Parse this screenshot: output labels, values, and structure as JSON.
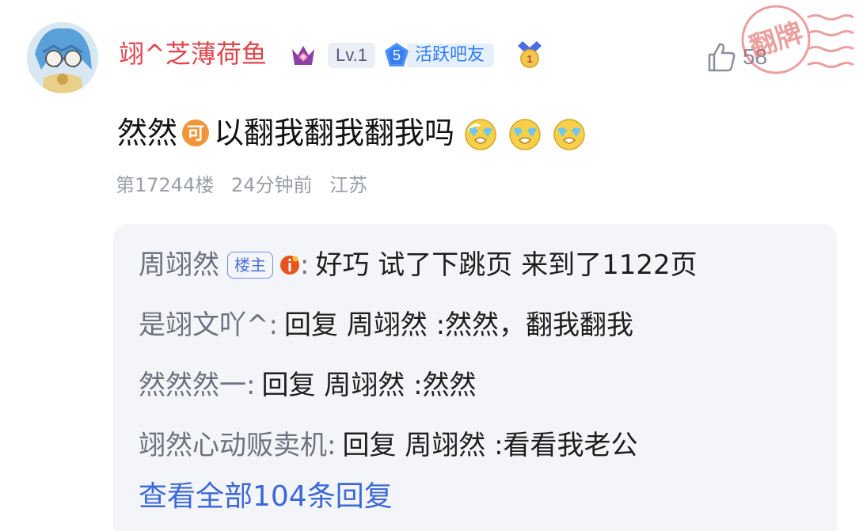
{
  "post": {
    "username": "翊^芝薄荷鱼",
    "level_badge": "Lv.1",
    "active_badge": {
      "number": "5",
      "label": "活跃吧友"
    },
    "like_count": "58",
    "stamp_text": "翻牌",
    "content_before": "然然",
    "content_emoji_ke": "可",
    "content_after": "以翻我翻我翻我吗",
    "meta": {
      "floor": "第17244楼",
      "time": "24分钟前",
      "location": "江苏"
    }
  },
  "replies": [
    {
      "author": "周翊然",
      "badge": "楼主",
      "text": "好巧 试了下跳页 来到了1122页"
    },
    {
      "author": "是翊文吖^",
      "text": "回复 周翊然 :然然，翻我翻我"
    },
    {
      "author": "然然然一",
      "text": "回复 周翊然 :然然"
    },
    {
      "author": "翊然心动贩卖机",
      "text": "回复 周翊然 :看看我老公"
    }
  ],
  "view_all_label": "查看全部104条回复",
  "colors": {
    "username": "#e0464d",
    "link": "#3c68d8",
    "reply_bg": "#f4f5f8",
    "meta": "#9a9ea8"
  }
}
